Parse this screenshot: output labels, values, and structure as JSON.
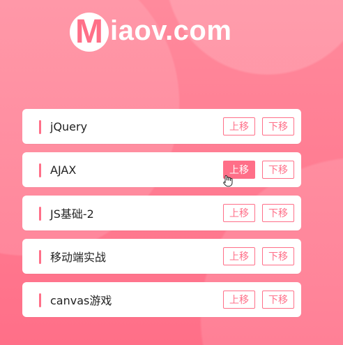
{
  "brand": {
    "logo_mark": "M",
    "logo_text": "iaov.com"
  },
  "items": [
    {
      "title": "jQuery",
      "up_label": "上移",
      "down_label": "下移"
    },
    {
      "title": "AJAX",
      "up_label": "上移",
      "down_label": "下移"
    },
    {
      "title": "JS基础-2",
      "up_label": "上移",
      "down_label": "下移"
    },
    {
      "title": "移动端实战",
      "up_label": "上移",
      "down_label": "下移"
    },
    {
      "title": "canvas游戏",
      "up_label": "上移",
      "down_label": "下移"
    }
  ],
  "colors": {
    "accent": "#ff6f88",
    "card": "#ffffff"
  }
}
